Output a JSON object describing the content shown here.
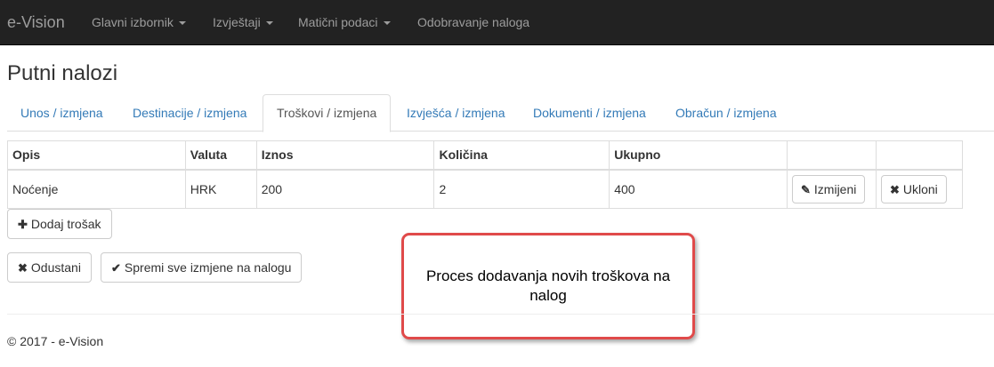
{
  "navbar": {
    "brand": "e-Vision",
    "items": [
      {
        "label": "Glavni izbornik",
        "dropdown": true
      },
      {
        "label": "Izvještaji",
        "dropdown": true
      },
      {
        "label": "Matični podaci",
        "dropdown": true
      },
      {
        "label": "Odobravanje naloga",
        "dropdown": false
      }
    ]
  },
  "page": {
    "title": "Putni nalozi"
  },
  "tabs": [
    {
      "label": "Unos / izmjena",
      "active": false
    },
    {
      "label": "Destinacije / izmjena",
      "active": false
    },
    {
      "label": "Troškovi / izmjena",
      "active": true
    },
    {
      "label": "Izvješća / izmjena",
      "active": false
    },
    {
      "label": "Dokumenti / izmjena",
      "active": false
    },
    {
      "label": "Obračun / izmjena",
      "active": false
    }
  ],
  "table": {
    "headers": [
      "Opis",
      "Valuta",
      "Iznos",
      "Količina",
      "Ukupno",
      "",
      ""
    ],
    "rows": [
      {
        "opis": "Noćenje",
        "valuta": "HRK",
        "iznos": "200",
        "kolicina": "2",
        "ukupno": "400",
        "edit_label": "Izmijeni",
        "remove_label": "Ukloni"
      }
    ]
  },
  "actions": {
    "add_cost": "Dodaj trošak",
    "cancel": "Odustani",
    "save_all": "Spremi sve izmjene na nalogu"
  },
  "callout": {
    "text": "Proces dodavanja novih troškova na nalog"
  },
  "footer": {
    "text": "© 2017 - e-Vision"
  },
  "colors": {
    "navbar_bg": "#222222",
    "link": "#337ab7",
    "callout_border": "#e04a4a"
  },
  "icons": {
    "add": "plus-icon",
    "cancel": "close-icon",
    "save": "check-icon",
    "edit": "edit-icon",
    "remove": "close-icon"
  }
}
